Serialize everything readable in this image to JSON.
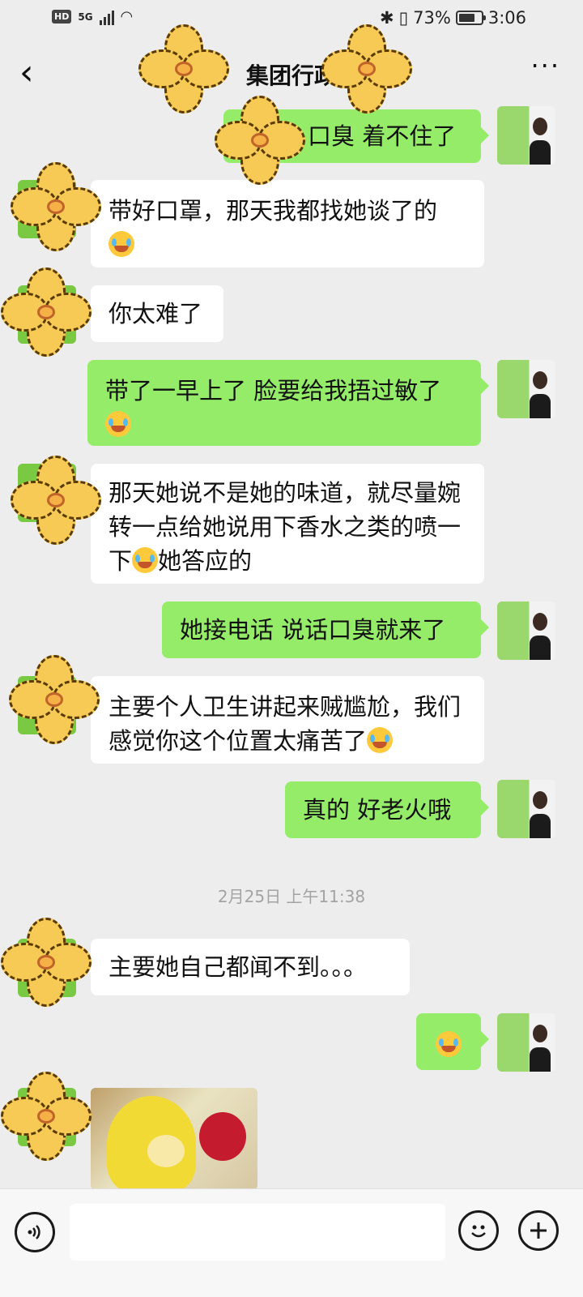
{
  "status_bar": {
    "hd": "HD",
    "network": "5G",
    "battery": "73%",
    "battery_level": 0.73,
    "time": "3:06"
  },
  "header": {
    "title": "集团行政",
    "back_icon": "chevron-left-icon",
    "more_icon": "more-dots-icon"
  },
  "messages": [
    {
      "side": "out",
      "text": "口臭  着不住了"
    },
    {
      "side": "in",
      "text": "带好口罩，那天我都找她谈了的",
      "emoji": "crying-laughing-emoji"
    },
    {
      "side": "in",
      "text": "你太难了"
    },
    {
      "side": "out",
      "text": "带了一早上了  脸要给我捂过敏了",
      "emoji": "crying-laughing-emoji"
    },
    {
      "side": "in",
      "text_line1": "那天她说不是她的味道，就尽量婉",
      "text_line2": "转一点给她说用下香水之类的喷一",
      "text_line3_a": "下",
      "emoji": "crying-laughing-emoji",
      "text_line3_b": "她答应的"
    },
    {
      "side": "out",
      "text": "她接电话  说话口臭就来了"
    },
    {
      "side": "in",
      "text_line1": "主要个人卫生讲起来贼尴尬，我们",
      "text_line2": "感觉你这个位置太痛苦了",
      "emoji": "crying-laughing-emoji"
    },
    {
      "side": "out",
      "text": "真的  好老火哦"
    },
    {
      "side": "in",
      "text": "主要她自己都闻不到。。。"
    },
    {
      "side": "out",
      "emoji": "sad-face-emoji"
    },
    {
      "side": "in",
      "sticker": "teletubbies-sticker"
    }
  ],
  "timestamp": "2月25日 上午11:38",
  "input_bar": {
    "voice_icon": "voice-icon",
    "emoji_icon": "smile-icon",
    "plus_icon": "plus-icon"
  }
}
